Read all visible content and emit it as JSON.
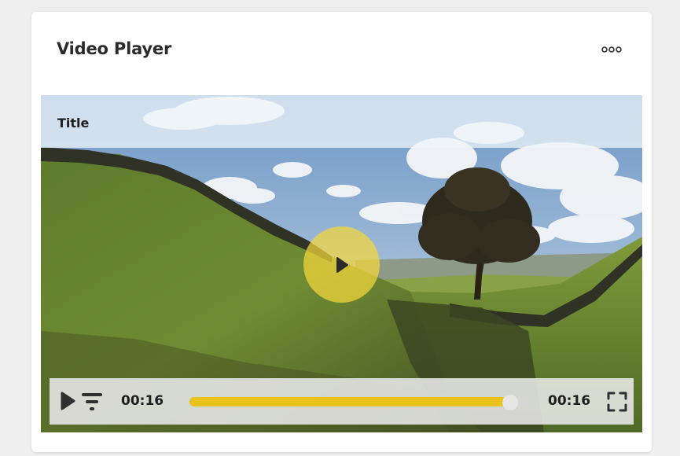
{
  "card": {
    "title": "Video Player",
    "menu_icon": "more-dots-icon"
  },
  "video": {
    "title": "Title",
    "current_time": "00:16",
    "duration": "00:16",
    "progress": 0.97,
    "icons": {
      "big_play": "play-icon",
      "play": "play-icon",
      "quality": "filter-icon",
      "fullscreen": "fullscreen-icon"
    }
  },
  "colors": {
    "accent": "#e9c21a",
    "play_overlay": "#f5d73c"
  }
}
